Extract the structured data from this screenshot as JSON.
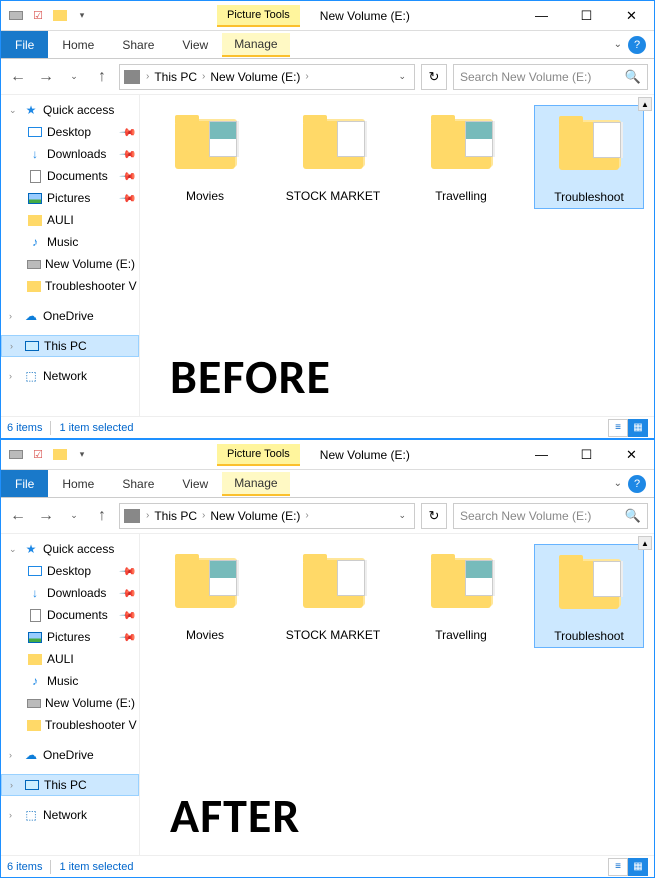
{
  "windows": [
    {
      "context_tab": "Picture Tools",
      "title": "New Volume (E:)",
      "ribbon": {
        "file": "File",
        "tabs": [
          "Home",
          "Share",
          "View"
        ],
        "context_tab": "Manage"
      },
      "breadcrumb": [
        "This PC",
        "New Volume (E:)"
      ],
      "search_placeholder": "Search New Volume (E:)",
      "sidebar": {
        "quick": "Quick access",
        "items": [
          {
            "icon": "desk",
            "label": "Desktop",
            "pinned": true
          },
          {
            "icon": "down",
            "label": "Downloads",
            "pinned": true
          },
          {
            "icon": "doc",
            "label": "Documents",
            "pinned": true
          },
          {
            "icon": "pic",
            "label": "Pictures",
            "pinned": true
          },
          {
            "icon": "yellow",
            "label": "AULI",
            "pinned": false
          },
          {
            "icon": "music",
            "label": "Music",
            "pinned": false
          },
          {
            "icon": "drive",
            "label": "New Volume (E:)",
            "pinned": false
          },
          {
            "icon": "yellow",
            "label": "Troubleshooter V",
            "pinned": false
          }
        ],
        "onedrive": "OneDrive",
        "thispc": "This PC",
        "network": "Network"
      },
      "items": [
        {
          "label": "Movies",
          "preview": "pic",
          "selected": false
        },
        {
          "label": "STOCK MARKET",
          "preview": "doc",
          "selected": false
        },
        {
          "label": "Travelling",
          "preview": "pic",
          "selected": false
        },
        {
          "label": "Troubleshoot",
          "preview": "doc",
          "selected": true
        }
      ],
      "overlay": "BEFORE",
      "status": {
        "count": "6 items",
        "selected": "1 item selected"
      }
    },
    {
      "context_tab": "Picture Tools",
      "title": "New Volume (E:)",
      "ribbon": {
        "file": "File",
        "tabs": [
          "Home",
          "Share",
          "View"
        ],
        "context_tab": "Manage"
      },
      "breadcrumb": [
        "This PC",
        "New Volume (E:)"
      ],
      "search_placeholder": "Search New Volume (E:)",
      "sidebar": {
        "quick": "Quick access",
        "items": [
          {
            "icon": "desk",
            "label": "Desktop",
            "pinned": true
          },
          {
            "icon": "down",
            "label": "Downloads",
            "pinned": true
          },
          {
            "icon": "doc",
            "label": "Documents",
            "pinned": true
          },
          {
            "icon": "pic",
            "label": "Pictures",
            "pinned": true
          },
          {
            "icon": "yellow",
            "label": "AULI",
            "pinned": false
          },
          {
            "icon": "music",
            "label": "Music",
            "pinned": false
          },
          {
            "icon": "drive",
            "label": "New Volume (E:)",
            "pinned": false
          },
          {
            "icon": "yellow",
            "label": "Troubleshooter V",
            "pinned": false
          }
        ],
        "onedrive": "OneDrive",
        "thispc": "This PC",
        "network": "Network"
      },
      "items": [
        {
          "label": "Movies",
          "preview": "pic",
          "selected": false
        },
        {
          "label": "STOCK MARKET",
          "preview": "doc",
          "selected": false
        },
        {
          "label": "Travelling",
          "preview": "pic",
          "selected": false
        },
        {
          "label": "Troubleshoot",
          "preview": "doc",
          "selected": true
        }
      ],
      "overlay": "AFTER",
      "status": {
        "count": "6 items",
        "selected": "1 item selected"
      }
    }
  ]
}
